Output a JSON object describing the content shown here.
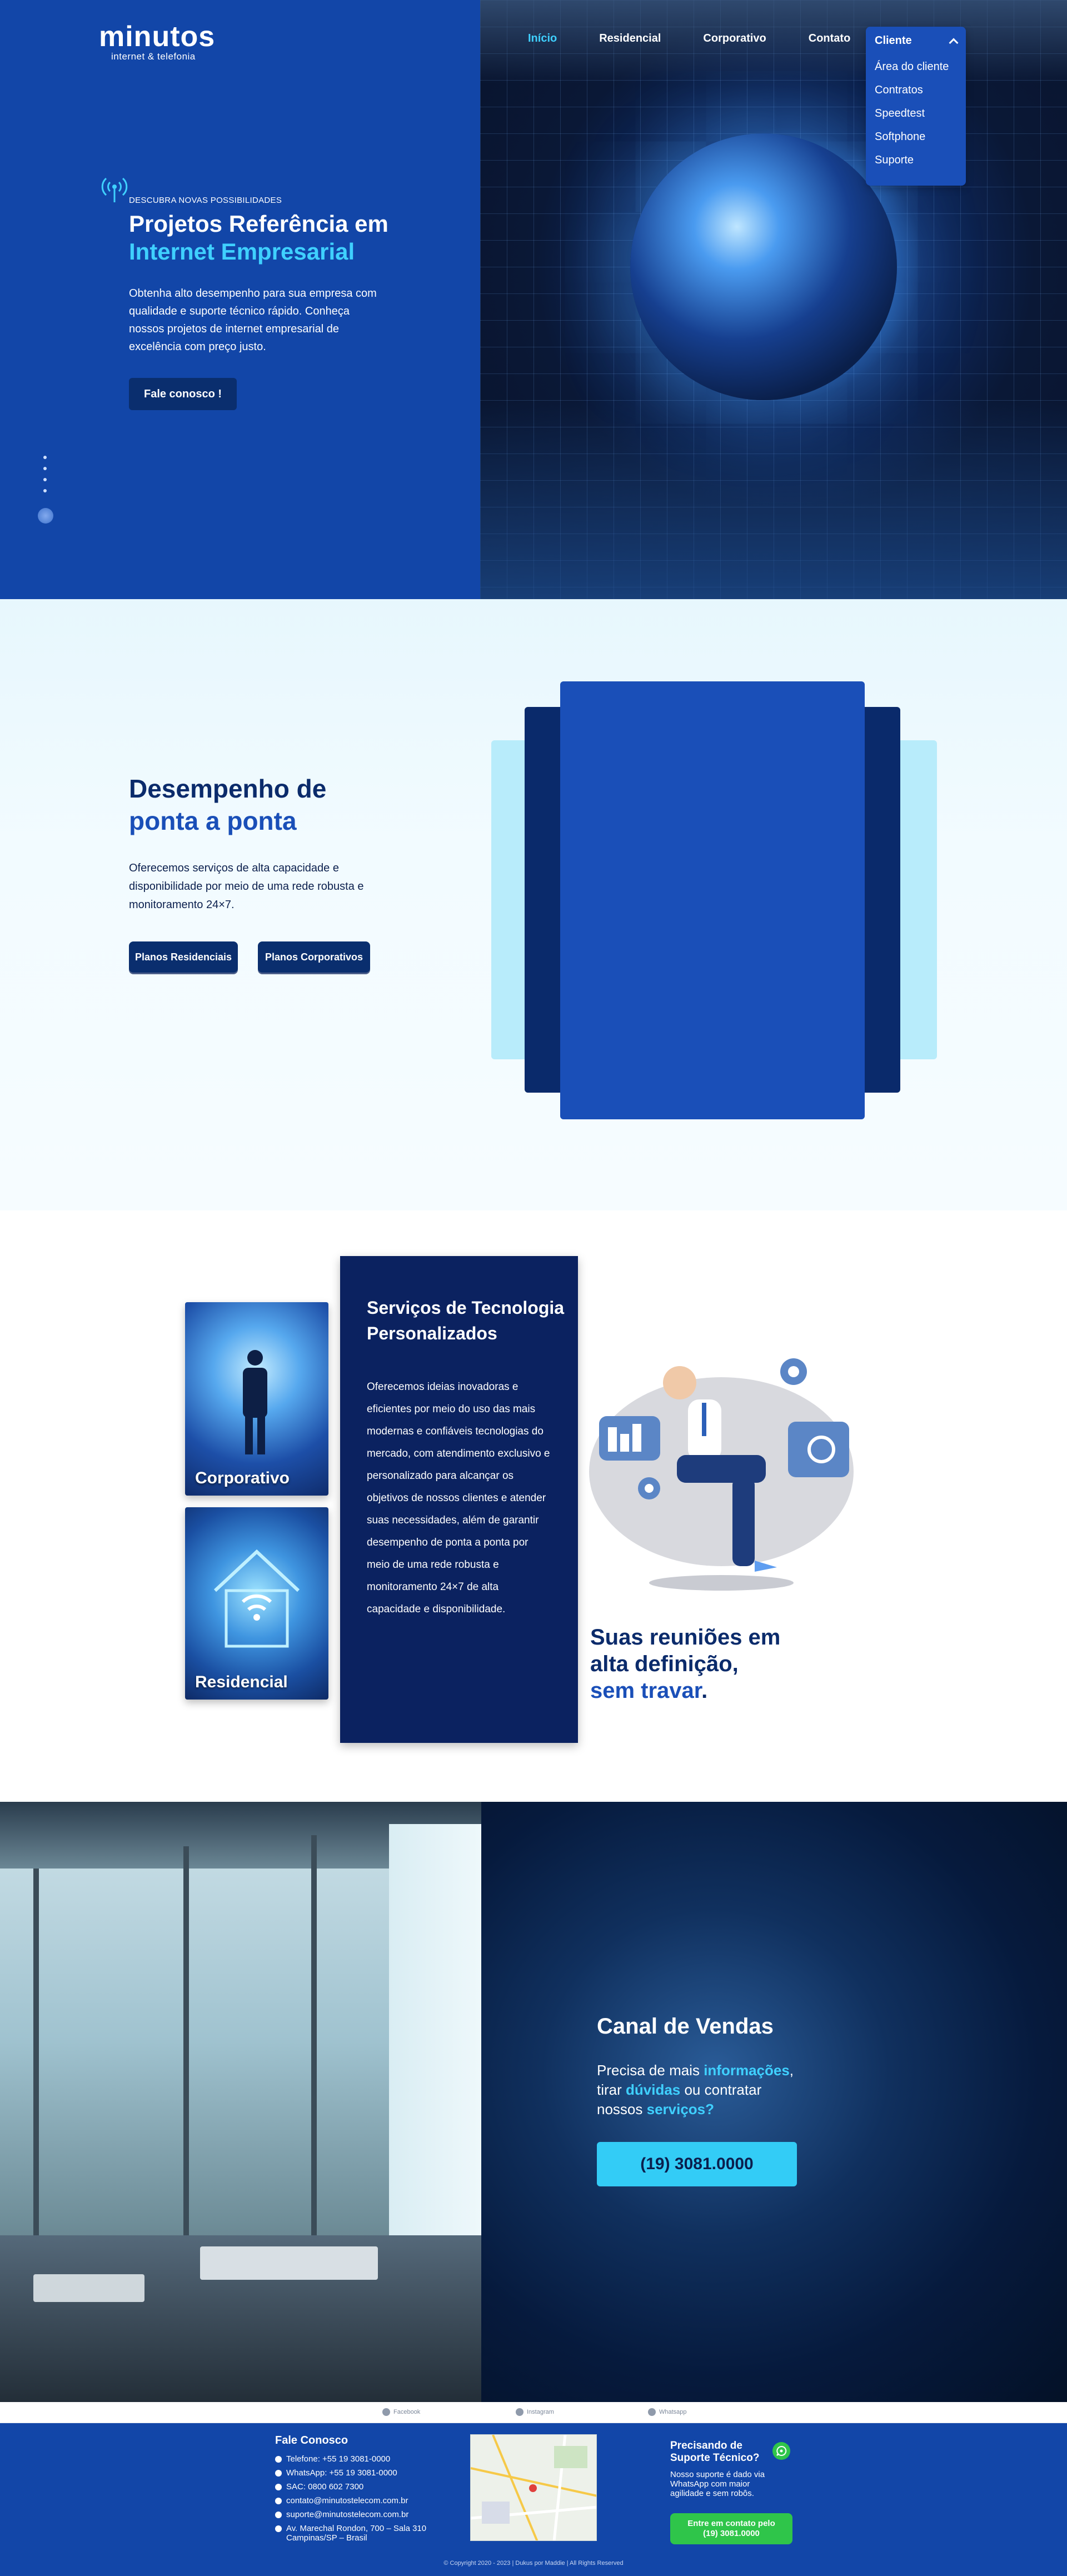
{
  "brand": {
    "name": "minutos",
    "tagline": "internet & telefonia"
  },
  "nav": {
    "items": [
      "Início",
      "Residencial",
      "Corporativo",
      "Contato"
    ],
    "cliente": {
      "label": "Cliente",
      "items": [
        "Área do cliente",
        "Contratos",
        "Speedtest",
        "Softphone",
        "Suporte"
      ]
    }
  },
  "hero": {
    "eyebrow": "DESCUBRA NOVAS POSSIBILIDADES",
    "title_line1": "Projetos Referência em",
    "title_line2": "Internet Empresarial",
    "text": "Obtenha alto desempenho para sua empresa com qualidade e suporte técnico rápido. Conheça nossos projetos de internet empresarial de excelência com preço justo.",
    "cta": "Fale conosco !"
  },
  "performance": {
    "title_line1": "Desempenho de",
    "title_line2": "ponta a ponta",
    "text": "Oferecemos serviços de alta capacidade e disponibilidade por meio de uma rede robusta e monitoramento 24×7.",
    "btn_residencial": "Planos Residenciais",
    "btn_corporativo": "Planos Corporativos"
  },
  "services": {
    "thumb_corporativo": "Corporativo",
    "thumb_residencial": "Residencial",
    "title": "Serviços de Tecnologia Personalizados",
    "text": "Oferecemos ideias inovadoras e eficientes por meio do uso das mais modernas e confiáveis tecnologias do mercado, com atendimento exclusivo e personalizado para alcançar os objetivos de nossos clientes e atender suas necessidades, além de garantir desempenho de ponta a ponta por meio de uma rede robusta e monitoramento 24×7 de alta capacidade e disponibilidade.",
    "meet_line1": "Suas reuniões em",
    "meet_line2": "alta definição,",
    "meet_line3": "sem travar",
    "meet_dot": "."
  },
  "sales": {
    "title": "Canal de Vendas",
    "t1": "Precisa de mais ",
    "h1": "informações",
    "t2": ",",
    "t3": "tirar ",
    "h2": "dúvidas",
    "t4": " ou contratar",
    "t5": "nossos ",
    "h3": "serviços",
    "t6": "?",
    "phone": "(19) 3081.0000"
  },
  "social": [
    "Facebook",
    "Instagram",
    "Whatsapp"
  ],
  "footer": {
    "contact_title": "Fale Conosco",
    "contacts": [
      "Telefone: +55 19 3081-0000",
      "WhatsApp: +55 19 3081-0000",
      "SAC: 0800 602 7300",
      "contato@minutostelecom.com.br",
      "suporte@minutostelecom.com.br",
      "Av. Marechal Rondon, 700 – Sala 310 Campinas/SP – Brasil"
    ],
    "support_title": "Precisando de Suporte Técnico?",
    "support_text": "Nosso suporte é dado via WhatsApp com maior agilidade e sem robôs.",
    "support_btn_line1": "Entre em contato pelo",
    "support_btn_line2": "(19) 3081.0000",
    "copyright": "© Copyright 2020 - 2023 | Dukus por Maddie | All Rights Reserved"
  },
  "colors": {
    "primary": "#1246a8",
    "navy": "#0a2e6e",
    "accent": "#3fd0ff",
    "whatsapp": "#2fc54a"
  }
}
